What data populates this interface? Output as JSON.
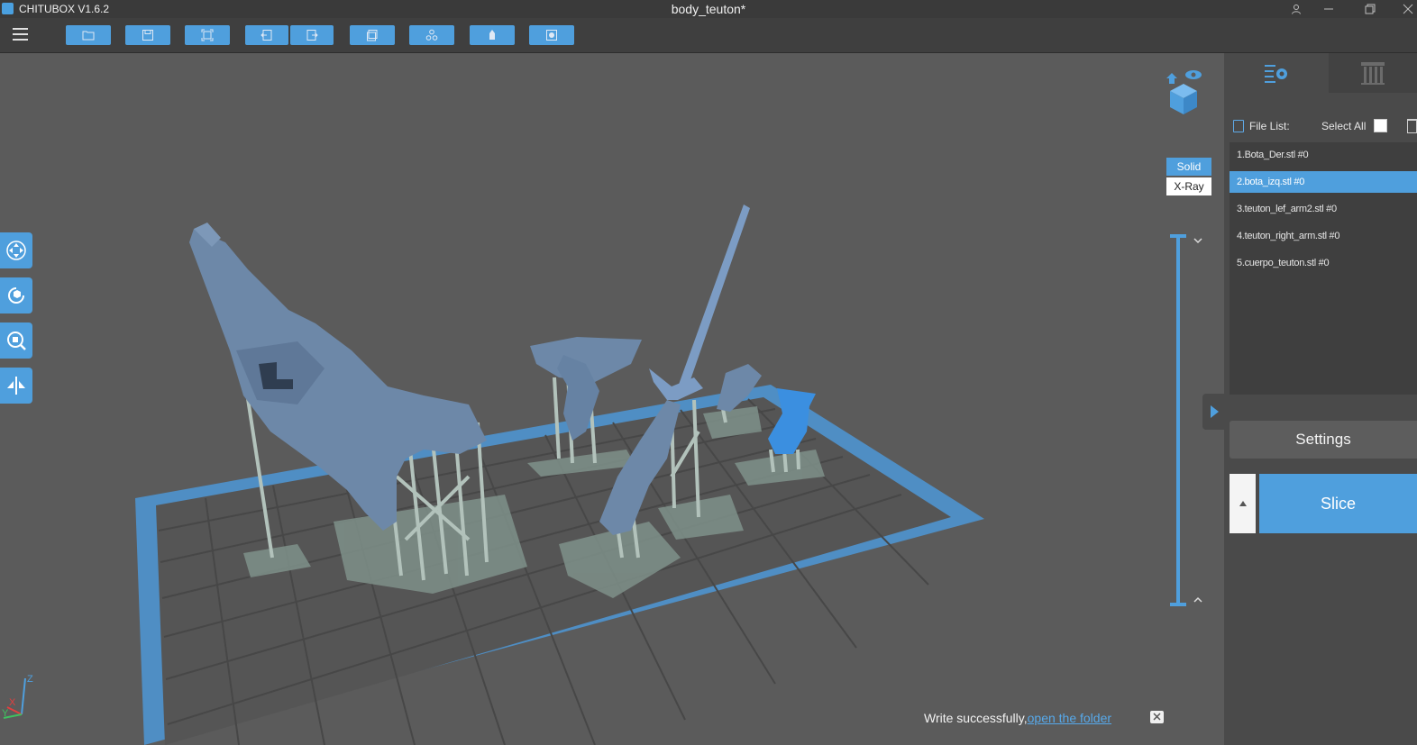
{
  "window": {
    "app_name": "CHITUBOX V1.6.2",
    "document_title": "body_teuton*"
  },
  "toolbar": {
    "buttons": [
      "open-file-icon",
      "save-icon",
      "fit-view-icon",
      "undo-icon",
      "redo-icon",
      "copy-icon",
      "arrange-icon",
      "support-icon",
      "hollow-icon"
    ]
  },
  "viewport": {
    "view_modes": {
      "solid": "Solid",
      "xray": "X-Ray"
    },
    "left_tools": [
      "move-icon",
      "rotate-icon",
      "scale-icon",
      "mirror-icon"
    ],
    "axis_labels": {
      "x": "X",
      "y": "Y",
      "z": "Z"
    },
    "notification": {
      "message": "Write successfully,",
      "link": "open the folder"
    }
  },
  "panel": {
    "file_list_label": "File List:",
    "select_all_label": "Select All",
    "files": [
      "1.Bota_Der.stl #0",
      "2.bota_izq.stl #0",
      "3.teuton_lef_arm2.stl #0",
      "4.teuton_right_arm.stl #0",
      "5.cuerpo_teuton.stl #0"
    ],
    "selected_index": 1,
    "settings_label": "Settings",
    "slice_label": "Slice"
  },
  "colors": {
    "accent": "#4f9fdd",
    "background": "#5b5b5b",
    "panel": "#4a4a4a",
    "model": "#6d88a8",
    "selected_model": "#3b8fe0",
    "support": "#a6b7b0"
  }
}
